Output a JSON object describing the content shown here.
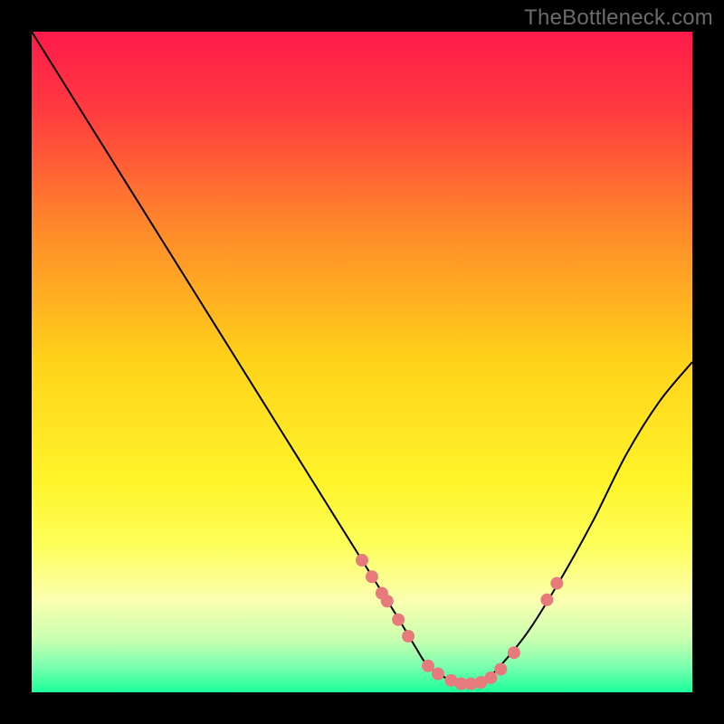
{
  "watermark": "TheBottleneck.com",
  "chart_data": {
    "type": "line",
    "title": "",
    "xlabel": "",
    "ylabel": "",
    "xlim": [
      0,
      100
    ],
    "ylim": [
      0,
      100
    ],
    "grid": false,
    "background": {
      "gradient_stops": [
        {
          "offset": 0.0,
          "color": "#ff1a4b"
        },
        {
          "offset": 0.12,
          "color": "#ff3b3f"
        },
        {
          "offset": 0.3,
          "color": "#ff8a2a"
        },
        {
          "offset": 0.5,
          "color": "#ffd31a"
        },
        {
          "offset": 0.68,
          "color": "#fff42a"
        },
        {
          "offset": 0.78,
          "color": "#fdff5c"
        },
        {
          "offset": 0.86,
          "color": "#fbffb0"
        },
        {
          "offset": 0.92,
          "color": "#c9ffb0"
        },
        {
          "offset": 0.96,
          "color": "#7dffb0"
        },
        {
          "offset": 1.0,
          "color": "#1aff9a"
        }
      ]
    },
    "series": [
      {
        "name": "bottleneck-curve",
        "color": "#000000",
        "stroke_width": 2,
        "x": [
          0,
          5,
          10,
          15,
          20,
          25,
          30,
          35,
          40,
          45,
          50,
          55,
          58,
          60,
          63,
          65,
          68,
          70,
          75,
          80,
          85,
          90,
          95,
          100
        ],
        "y": [
          100,
          92,
          84,
          76,
          68,
          60,
          52,
          44,
          36,
          28,
          20,
          12,
          7,
          4,
          2,
          1.3,
          1.5,
          3,
          9,
          17,
          26,
          36,
          44,
          50
        ]
      }
    ],
    "markers": {
      "name": "highlighted-points",
      "color": "#e77a7a",
      "radius": 7,
      "points": [
        {
          "x": 50.0,
          "y": 20.0
        },
        {
          "x": 51.5,
          "y": 17.5
        },
        {
          "x": 53.0,
          "y": 15.0
        },
        {
          "x": 53.8,
          "y": 13.8
        },
        {
          "x": 55.5,
          "y": 11.0
        },
        {
          "x": 57.0,
          "y": 8.5
        },
        {
          "x": 60.0,
          "y": 4.0
        },
        {
          "x": 61.5,
          "y": 2.8
        },
        {
          "x": 63.5,
          "y": 1.8
        },
        {
          "x": 65.0,
          "y": 1.3
        },
        {
          "x": 66.5,
          "y": 1.3
        },
        {
          "x": 68.0,
          "y": 1.5
        },
        {
          "x": 69.5,
          "y": 2.2
        },
        {
          "x": 71.0,
          "y": 3.5
        },
        {
          "x": 73.0,
          "y": 6.0
        },
        {
          "x": 78.0,
          "y": 14.0
        },
        {
          "x": 79.5,
          "y": 16.5
        }
      ]
    }
  }
}
